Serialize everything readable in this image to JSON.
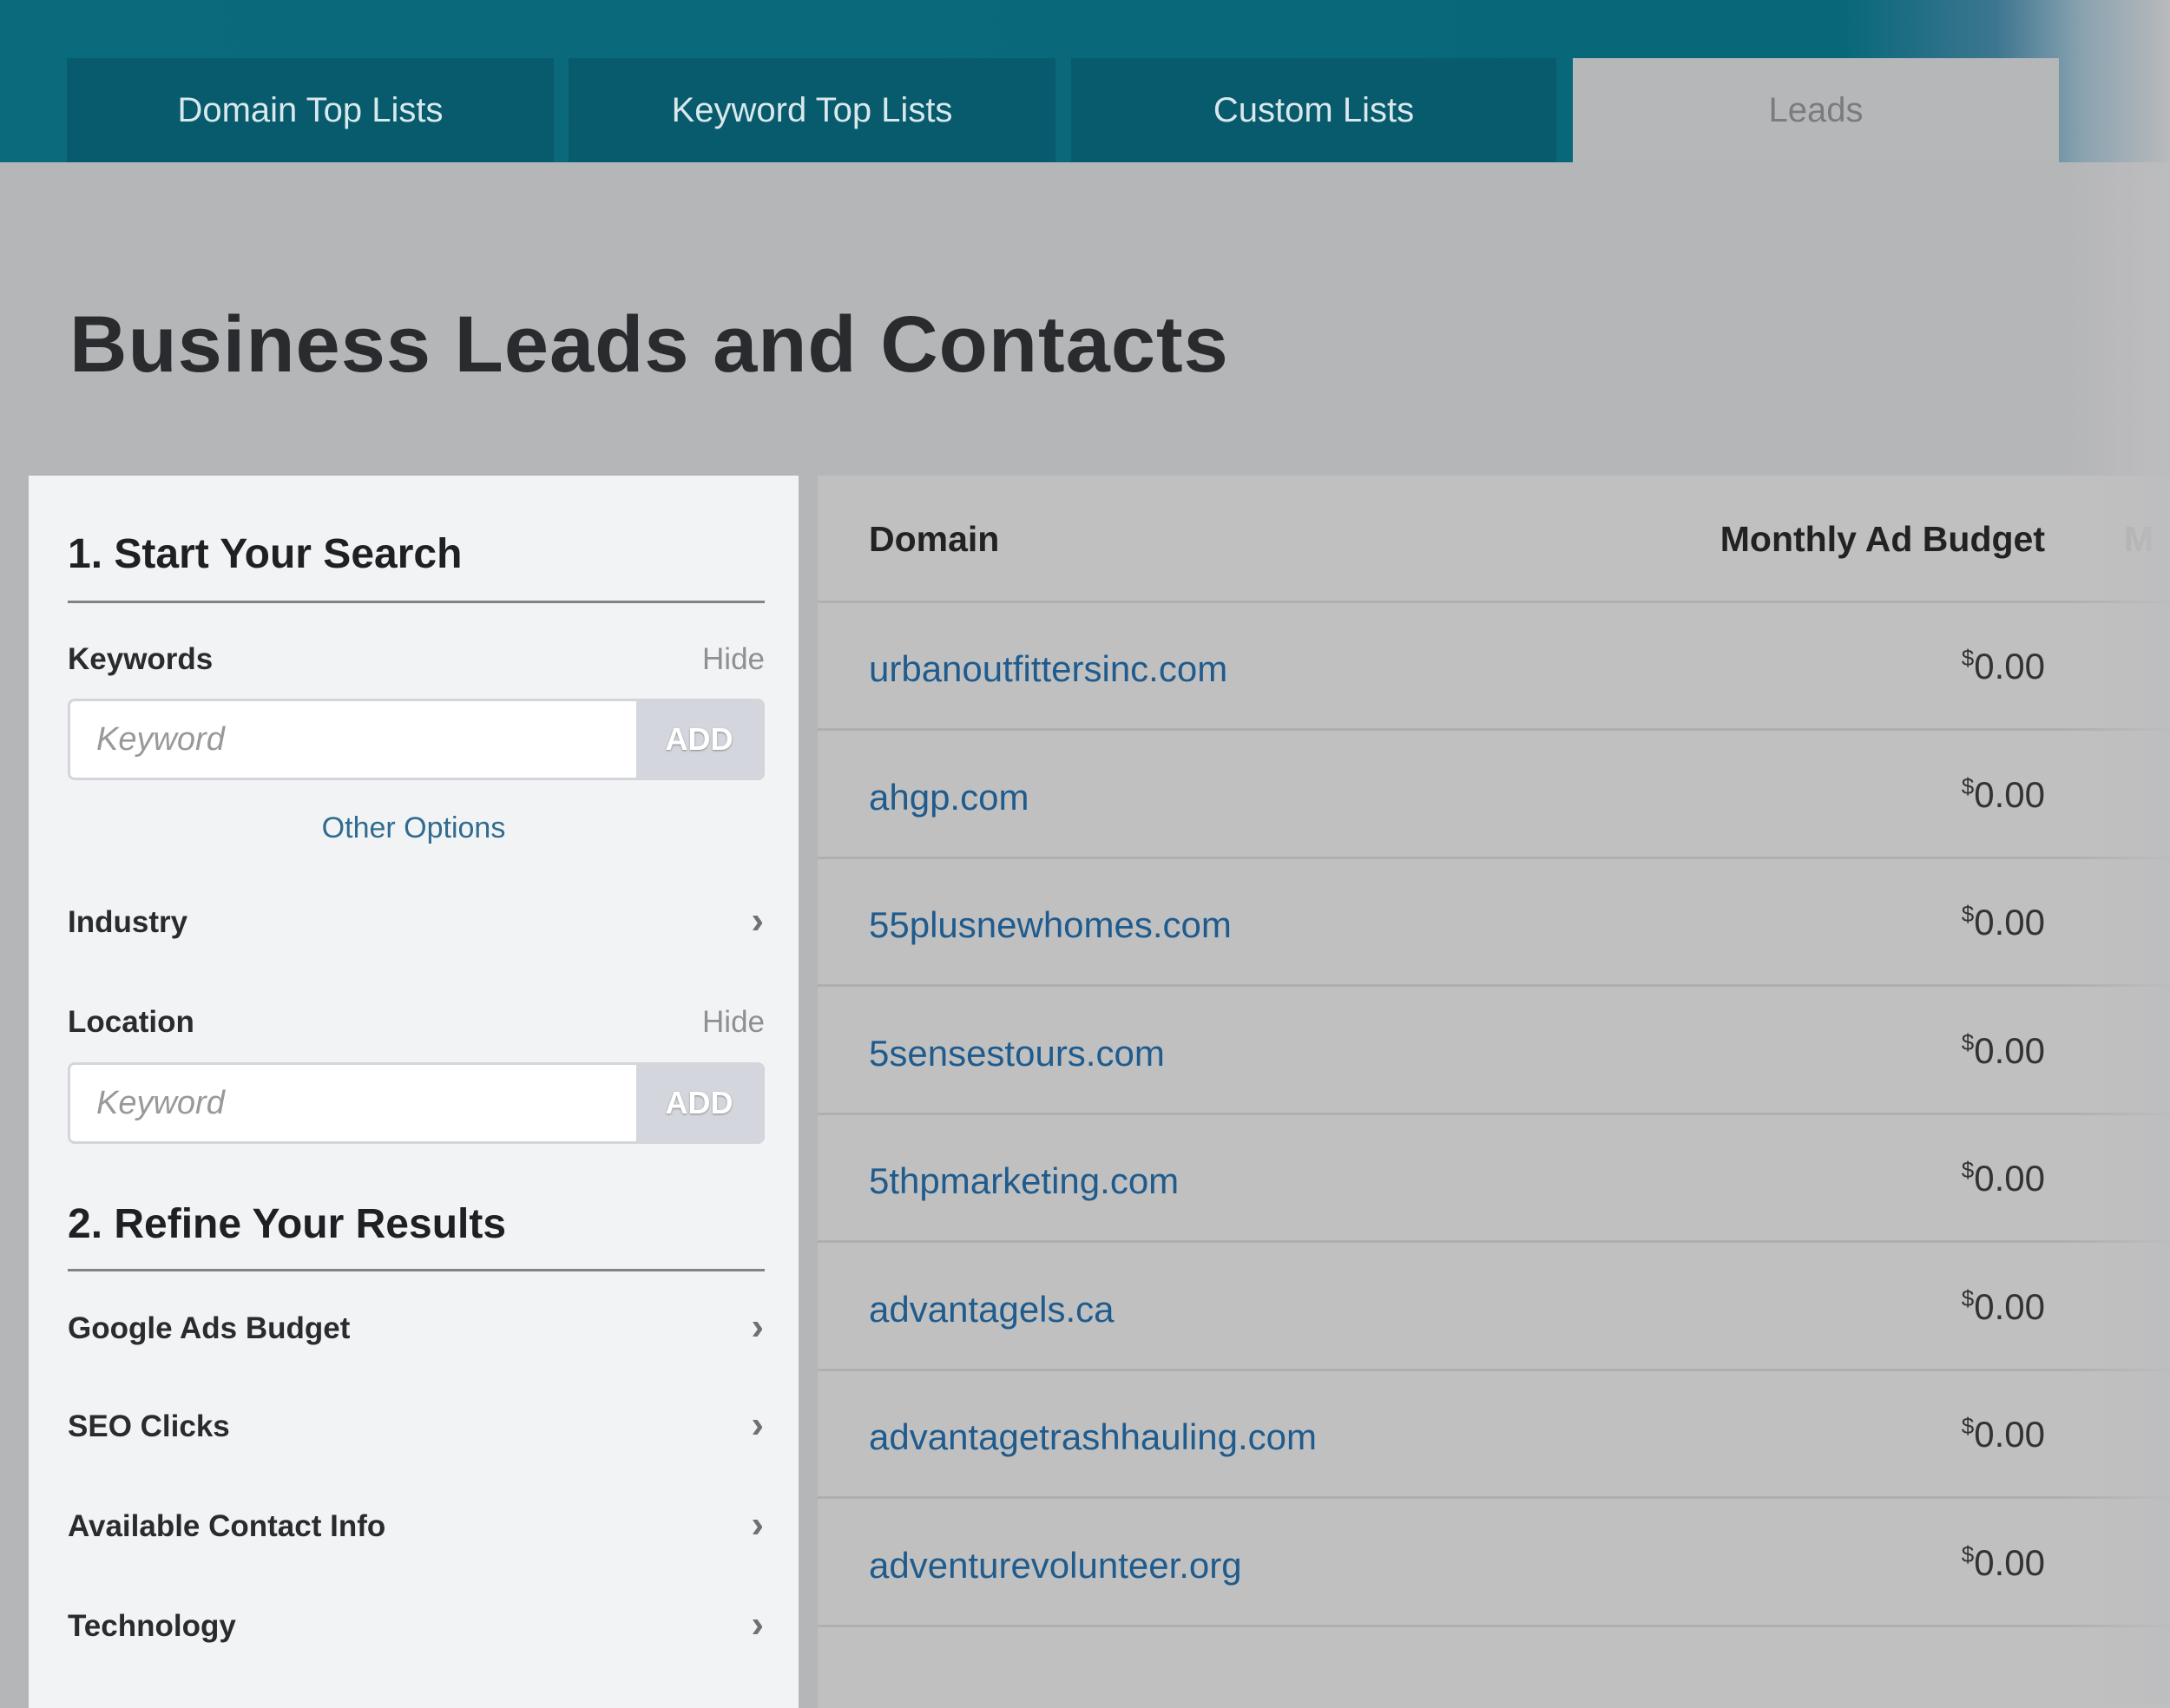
{
  "tabs": [
    {
      "label": "Domain Top Lists"
    },
    {
      "label": "Keyword Top Lists"
    },
    {
      "label": "Custom Lists"
    },
    {
      "label": "Leads",
      "active": true
    }
  ],
  "page_title": "Business Leads and Contacts",
  "sidebar": {
    "section1": "1. Start Your Search",
    "keywords": {
      "label": "Keywords",
      "hide": "Hide",
      "placeholder": "Keyword",
      "add": "ADD"
    },
    "other_options": "Other Options",
    "industry": "Industry",
    "location": {
      "label": "Location",
      "hide": "Hide",
      "placeholder": "Keyword",
      "add": "ADD"
    },
    "section2": "2. Refine Your Results",
    "filters": [
      "Google Ads Budget",
      "SEO Clicks",
      "Available Contact Info",
      "Technology"
    ]
  },
  "table": {
    "headers": [
      "Domain",
      "Monthly Ad Budget",
      "M"
    ],
    "currency": "$",
    "rows": [
      {
        "domain": "urbanoutfittersinc.com",
        "budget": "0.00"
      },
      {
        "domain": "ahgp.com",
        "budget": "0.00"
      },
      {
        "domain": "55plusnewhomes.com",
        "budget": "0.00"
      },
      {
        "domain": "5sensestours.com",
        "budget": "0.00"
      },
      {
        "domain": "5thpmarketing.com",
        "budget": "0.00"
      },
      {
        "domain": "advantagels.ca",
        "budget": "0.00"
      },
      {
        "domain": "advantagetrashhauling.com",
        "budget": "0.00"
      },
      {
        "domain": "adventurevolunteer.org",
        "budget": "0.00"
      }
    ]
  },
  "colors": {
    "brand": "#0a6b7c",
    "link": "#1f5b8d"
  }
}
